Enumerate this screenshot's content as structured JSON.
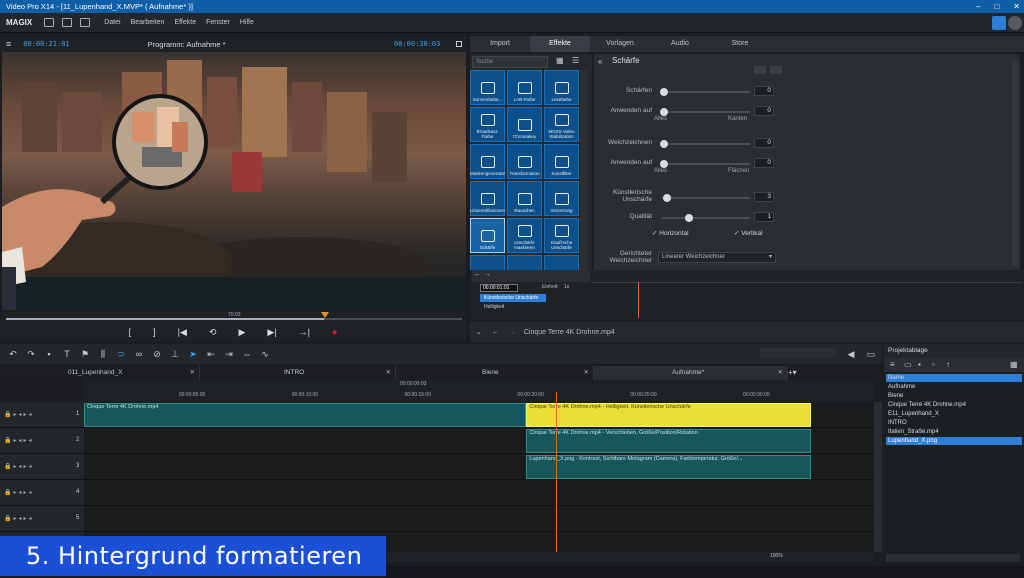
{
  "window": {
    "title": "Video Pro X14 - [11_Lupenhand_X.MVP* ( Aufnahme* )]",
    "controls": [
      "–",
      "□",
      "✕"
    ]
  },
  "menubar": {
    "logo": "MAGIX",
    "items": [
      "Datei",
      "Bearbeiten",
      "Effekte",
      "Fenster",
      "Hilfe"
    ]
  },
  "preview": {
    "timecode_left": "00:00:21:01",
    "title": "Programm: Aufnahme *",
    "timecode_right": "00:00:30:03",
    "scrub_label": "70:03",
    "transport": [
      "[",
      "]",
      "|◀",
      "⟲",
      "▶",
      "▶|",
      "→|",
      "●"
    ]
  },
  "tabs": [
    "Import",
    "Effekte",
    "Vorlagen",
    "Audio",
    "Store"
  ],
  "active_tab": "Effekte",
  "effects": {
    "search_placeholder": "Suche",
    "grid": [
      {
        "label": "Sonnenfarbe..."
      },
      {
        "label": "LAB-Farbe"
      },
      {
        "label": "Lesefarbe"
      },
      {
        "label": "Broadcast-Farbe"
      },
      {
        "label": "Chromakey"
      },
      {
        "label": "MGXS Video Stabilization"
      },
      {
        "label": "Maskengenerator"
      },
      {
        "label": "Transformation"
      },
      {
        "label": "Kunstfilter"
      },
      {
        "label": "Linsenreflexionen"
      },
      {
        "label": "Rauschen"
      },
      {
        "label": "Verzerrung"
      },
      {
        "label": "Schärfe"
      },
      {
        "label": "Unschärfe maskieren"
      },
      {
        "label": "Gauß'sche Unschärfe"
      },
      {
        "label": ""
      },
      {
        "label": ""
      },
      {
        "label": ""
      }
    ],
    "selected": "Schärfe"
  },
  "settings": {
    "title": "Schärfe",
    "rows": [
      {
        "label": "Schärfen",
        "value": "0",
        "knob_fraction": 0
      },
      {
        "label": "Anwenden auf",
        "value": "0",
        "knob_fraction": 0,
        "left": "Alles",
        "right": "Kanten"
      },
      {
        "label": "Weichzeichnen",
        "value": "0",
        "knob_fraction": 0
      },
      {
        "label": "Anwenden auf",
        "value": "0",
        "knob_fraction": 0,
        "left": "Alles",
        "right": "Flächen"
      },
      {
        "label": "Künstlerische Unschärfe",
        "value": "3",
        "knob_fraction": 0.03
      },
      {
        "label": "Qualität",
        "value": "1",
        "knob_fraction": 0.3
      }
    ],
    "checkbox_horizontal": "Horizontal",
    "checkbox_vertical": "Vertikal",
    "dropdown_label": "Gerichteter Weichzeichner",
    "dropdown_value": "Linearer Weichzeichner"
  },
  "fxlist": {
    "timecode": "00:00:01:01",
    "unit_label": "Einheit:",
    "unit_value": "1s",
    "items": [
      "Künstlerische Unschärfe",
      "Helligkeit"
    ]
  },
  "fxnav": {
    "clip_name": "Cinque Terre 4K Drohne.mp4"
  },
  "timeline": {
    "tabs": [
      "011_Lupenhand_X",
      "INTRO",
      "Biene",
      "Aufnahme*"
    ],
    "ruler_top": "00:00:00:03",
    "ruler_ticks": [
      "00:00:05:00",
      "00:00:10:00",
      "00:00:15:00",
      "00:00:20:00",
      "00:00:25:00",
      "00:00:30:00"
    ],
    "track_numbers": [
      "1",
      "2",
      "3",
      "4",
      "5"
    ],
    "clips": [
      {
        "track": 0,
        "label": "Cinque Terre 4K Drohne.mp4",
        "start": 0,
        "end": 19.6,
        "style": "teal"
      },
      {
        "track": 0,
        "label": "Cinque Terre 4K Drohne.mp4 - Helligkeit, Künstlerische Unschärfe",
        "start": 19.6,
        "end": 32.2,
        "style": "yellow"
      },
      {
        "track": 1,
        "label": "Cinque Terre 4K Drohne.mp4 - Verschieben, Größe/Position/Rotation",
        "start": 19.6,
        "end": 32.2,
        "style": "teal"
      },
      {
        "track": 2,
        "label": "Lupenhand_X.png - Kontrast, Sichtbare Metagram (Camera), Farbtemperatur, Größe/...",
        "start": 19.6,
        "end": 32.2,
        "style": "teal"
      }
    ],
    "playhead_time": 20.9,
    "zoom": "100%"
  },
  "project_bin": {
    "title": "Projektablage",
    "column_header": "Name",
    "items": [
      "Aufnahme",
      "Biene",
      "Cinque Terre 4K Drohne.mp4",
      "E11_Lupenhand_X",
      "INTRO",
      "Italien_Straße.mp4",
      "Lupenhand_X.png"
    ],
    "highlighted": "Lupenhand_X.png"
  },
  "caption": "5. Hintergrund formatieren",
  "colors": {
    "accent": "#0f5fa8",
    "caption": "#1a4fd6",
    "clip_teal": "#17575a",
    "clip_yellow": "#e8e035",
    "playhead": "#e06a2a"
  }
}
